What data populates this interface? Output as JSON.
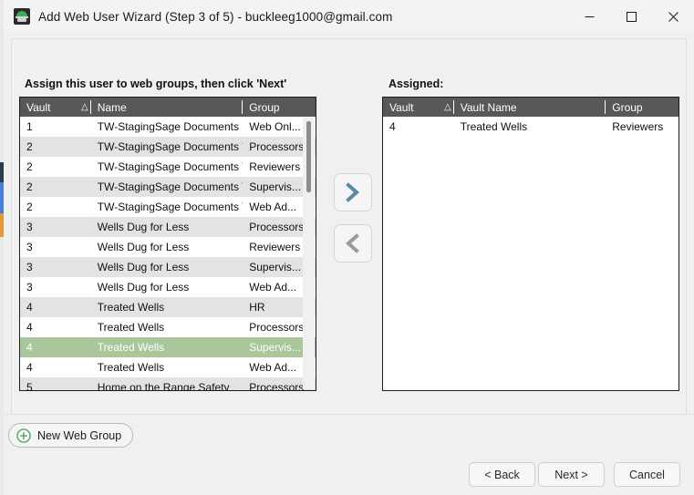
{
  "window": {
    "title": "Add Web User Wizard (Step 3 of 5) - buckleeg1000@gmail.com",
    "icon": "app-vault-icon",
    "controls": {
      "minimize": "minimize-icon",
      "maximize": "maximize-icon",
      "close": "close-icon"
    }
  },
  "colors": {
    "selection_green": "#a9c79b",
    "header_gray": "#585858",
    "accent_blue": "#5b89a6",
    "accent_green": "#5cae68",
    "row_alt": "#e3e3e3"
  },
  "left_panel": {
    "prompt": "Assign this user to web groups, then click 'Next'",
    "columns": [
      "Vault",
      "Name",
      "Group"
    ],
    "sort_indicator": "△",
    "sorted_column": "Vault",
    "rows": [
      {
        "vault": "1",
        "name": "TW-StagingSage Documents",
        "group": "Web Onl...",
        "selected": false
      },
      {
        "vault": "2",
        "name": "TW-StagingSage Documents Test",
        "group": "Processors",
        "selected": false
      },
      {
        "vault": "2",
        "name": "TW-StagingSage Documents Test",
        "group": "Reviewers",
        "selected": false
      },
      {
        "vault": "2",
        "name": "TW-StagingSage Documents Test",
        "group": "Supervis...",
        "selected": false
      },
      {
        "vault": "2",
        "name": "TW-StagingSage Documents Test",
        "group": "Web Ad...",
        "selected": false
      },
      {
        "vault": "3",
        "name": "Wells Dug for Less",
        "group": "Processors",
        "selected": false
      },
      {
        "vault": "3",
        "name": "Wells Dug for Less",
        "group": "Reviewers",
        "selected": false
      },
      {
        "vault": "3",
        "name": "Wells Dug for Less",
        "group": "Supervis...",
        "selected": false
      },
      {
        "vault": "3",
        "name": "Wells Dug for Less",
        "group": "Web Ad...",
        "selected": false
      },
      {
        "vault": "4",
        "name": "Treated Wells",
        "group": "HR",
        "selected": false
      },
      {
        "vault": "4",
        "name": "Treated Wells",
        "group": "Processors",
        "selected": false
      },
      {
        "vault": "4",
        "name": "Treated Wells",
        "group": "Supervis...",
        "selected": true
      },
      {
        "vault": "4",
        "name": "Treated Wells",
        "group": "Web Ad...",
        "selected": false
      },
      {
        "vault": "5",
        "name": "Home on the Range Safety",
        "group": "Processors",
        "selected": false
      }
    ]
  },
  "right_panel": {
    "prompt": "Assigned:",
    "columns": [
      "Vault",
      "Vault Name",
      "Group"
    ],
    "sort_indicator": "△",
    "sorted_column": "Vault",
    "rows": [
      {
        "vault": "4",
        "name": "Treated Wells",
        "group": "Reviewers",
        "selected": false
      }
    ]
  },
  "transfer": {
    "add_label": "move-right",
    "remove_label": "move-left"
  },
  "footer": {
    "new_group_label": "New Web Group",
    "back_label": "< Back",
    "next_label": "Next >",
    "cancel_label": "Cancel"
  }
}
